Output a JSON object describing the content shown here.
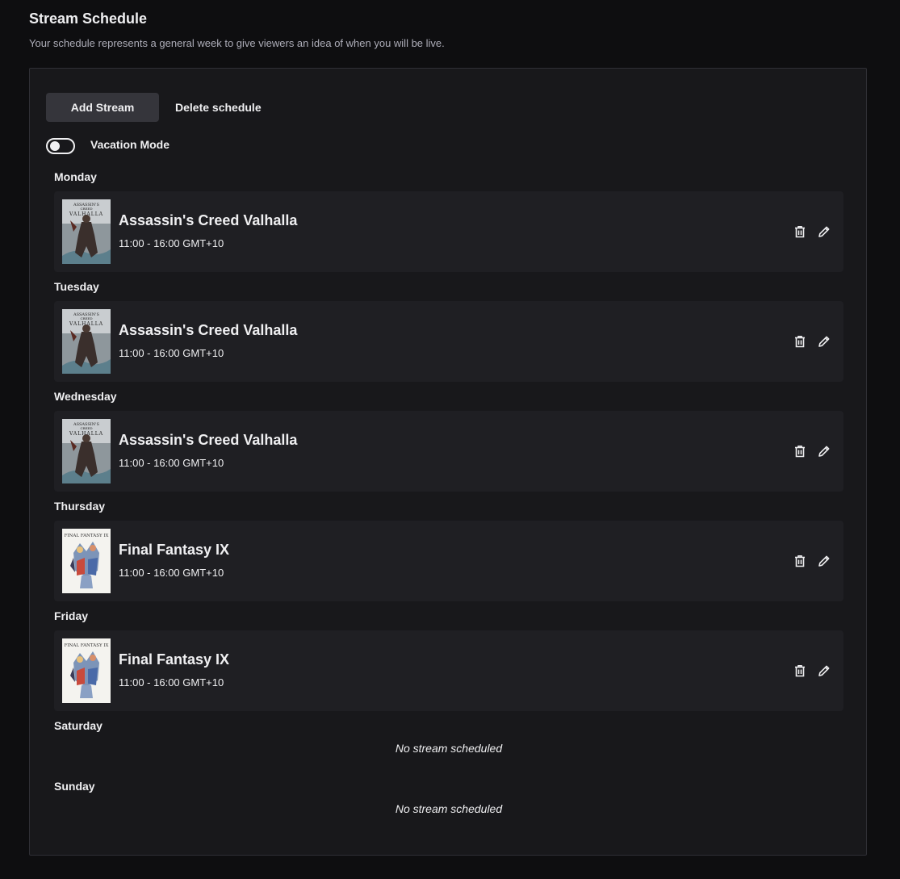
{
  "header": {
    "title": "Stream Schedule",
    "subtitle": "Your schedule represents a general week to give viewers an idea of when you will be live."
  },
  "toolbar": {
    "add_label": "Add Stream",
    "delete_label": "Delete schedule"
  },
  "vacation": {
    "label": "Vacation Mode",
    "enabled": false
  },
  "days": [
    {
      "name": "Monday",
      "stream": {
        "game": "Assassin's Creed Valhalla",
        "time": "11:00 - 16:00 GMT+10",
        "cover": "valhalla"
      }
    },
    {
      "name": "Tuesday",
      "stream": {
        "game": "Assassin's Creed Valhalla",
        "time": "11:00 - 16:00 GMT+10",
        "cover": "valhalla"
      }
    },
    {
      "name": "Wednesday",
      "stream": {
        "game": "Assassin's Creed Valhalla",
        "time": "11:00 - 16:00 GMT+10",
        "cover": "valhalla"
      }
    },
    {
      "name": "Thursday",
      "stream": {
        "game": "Final Fantasy IX",
        "time": "11:00 - 16:00 GMT+10",
        "cover": "ff9"
      }
    },
    {
      "name": "Friday",
      "stream": {
        "game": "Final Fantasy IX",
        "time": "11:00 - 16:00 GMT+10",
        "cover": "ff9"
      }
    },
    {
      "name": "Saturday",
      "empty_text": "No stream scheduled"
    },
    {
      "name": "Sunday",
      "empty_text": "No stream scheduled"
    }
  ],
  "cover_logos": {
    "valhalla": {
      "line1": "ASSASSIN'S",
      "line2": "CREED",
      "line3": "VALHALLA"
    },
    "ff9": {
      "line1": "FINAL FANTASY IX"
    }
  },
  "icons": {
    "delete": "trash-icon",
    "edit": "pencil-icon",
    "toggle": "toggle-switch"
  },
  "colors": {
    "background": "#0e0e10",
    "panel": "#18181b",
    "card": "#1f1f23",
    "button": "#35353b",
    "text": "#efeff1",
    "muted": "#adadb8"
  }
}
